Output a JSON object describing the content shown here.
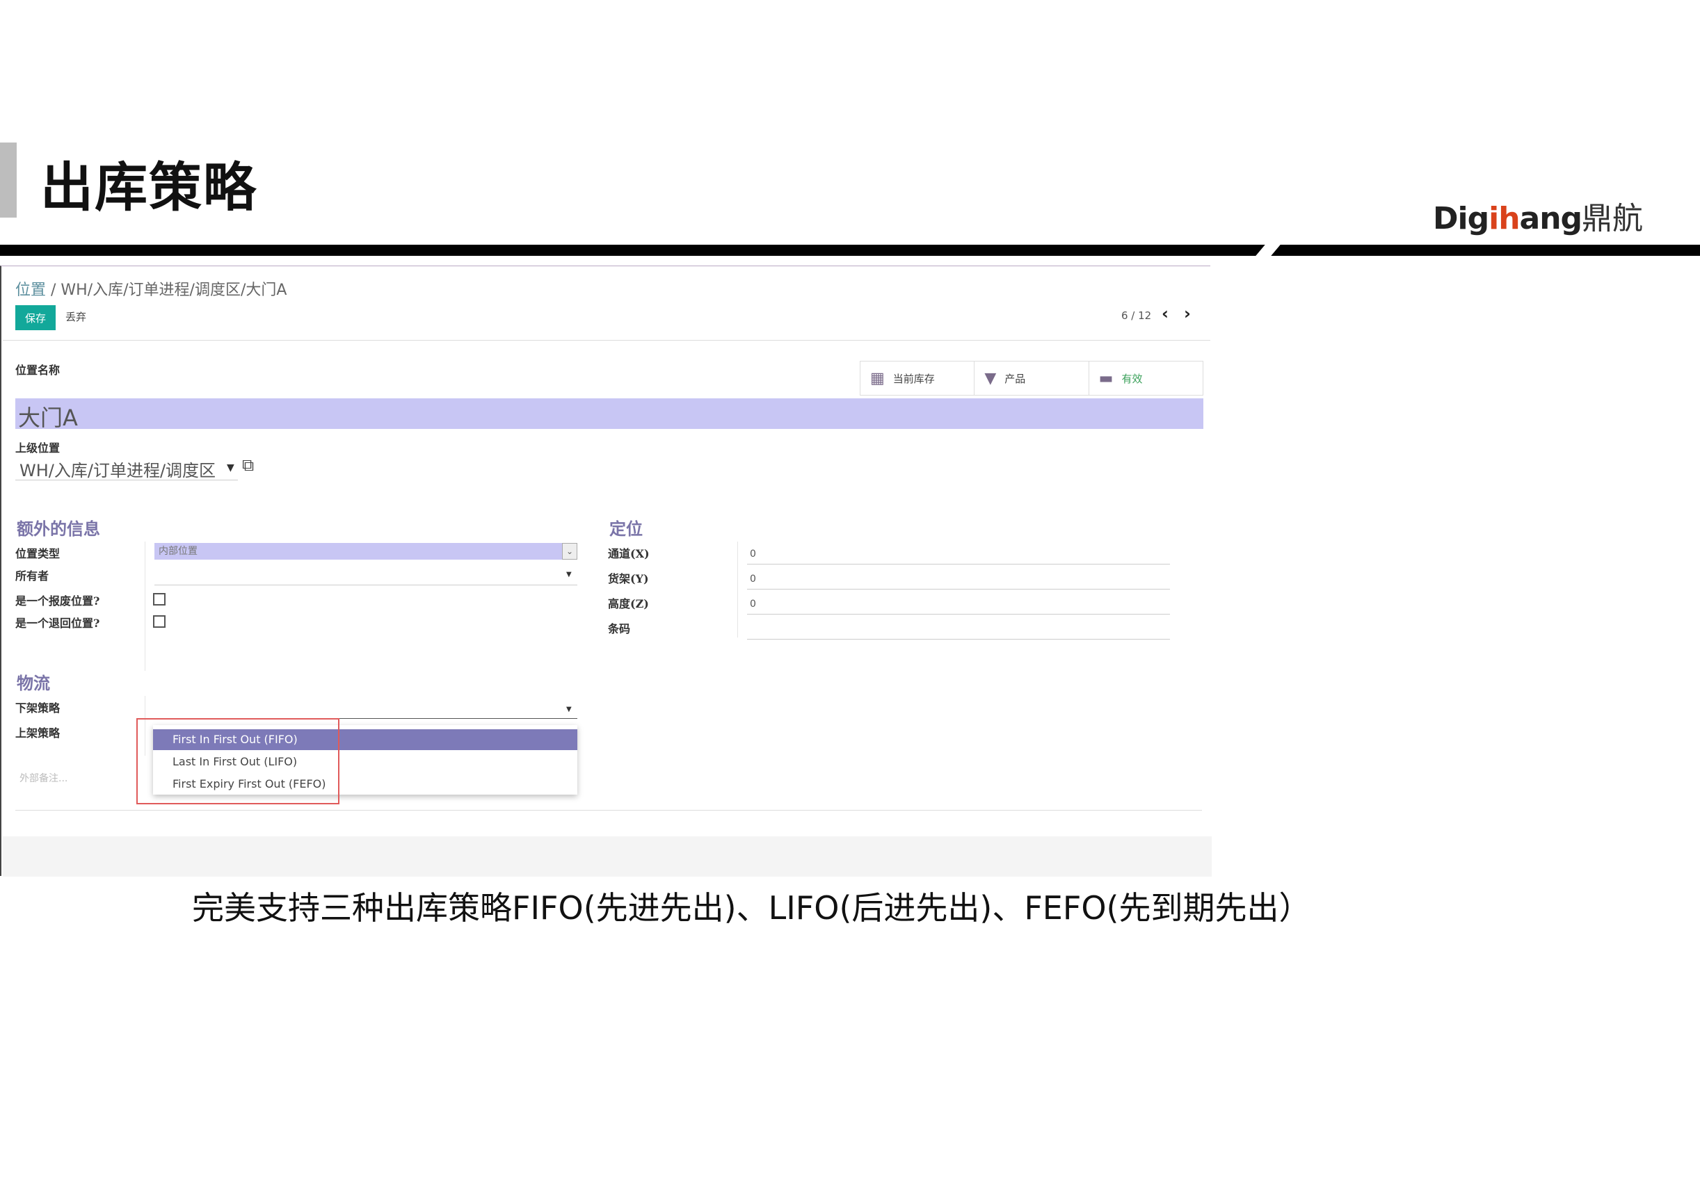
{
  "slide": {
    "title": "出库策略",
    "logo_pre": "Dig",
    "logo_hl": "ih",
    "logo_post": "ang",
    "logo_cn": "鼎航",
    "caption": "完美支持三种出库策略FIFO(先进先出)、LIFO(后进先出)、FEFO(先到期先出）"
  },
  "breadcrumb": {
    "root": "位置",
    "sep": " / ",
    "path": "WH/入库/订单进程/调度区/大门A"
  },
  "toolbar": {
    "save_label": "保存",
    "discard_label": "丢弃"
  },
  "pager": {
    "text": "6 / 12",
    "prev": "‹",
    "next": "›"
  },
  "smart_buttons": [
    {
      "label": "当前库存",
      "icon": "building-icon"
    },
    {
      "label": "产品",
      "icon": "filter-icon"
    },
    {
      "label": "有效",
      "icon": "archive-icon"
    }
  ],
  "form": {
    "name_label": "位置名称",
    "name_value": "大门A",
    "parent_label": "上级位置",
    "parent_value": "WH/入库/订单进程/调度区",
    "extra_section": "额外的信息",
    "location_type_label": "位置类型",
    "location_type_value": "内部位置",
    "owner_label": "所有者",
    "scrap_label": "是一个报废位置?",
    "return_label": "是一个退回位置?",
    "position_section": "定位",
    "aisle_label": "通道(X)",
    "aisle_value": "0",
    "shelf_label": "货架(Y)",
    "shelf_value": "0",
    "height_label": "高度(Z)",
    "height_value": "0",
    "barcode_label": "条码",
    "logistics_section": "物流",
    "removal_label": "下架策略",
    "putaway_label": "上架策略",
    "note_placeholder": "外部备注..."
  },
  "dropdown_options": [
    "First In First Out (FIFO)",
    "Last In First Out (LIFO)",
    "First Expiry First Out (FEFO)"
  ],
  "colors": {
    "accent": "#12a89a",
    "highlight": "#c8c6f4",
    "section": "#7a74a8",
    "option_active": "#7d7ab8",
    "annotation": "#e05a5a"
  }
}
